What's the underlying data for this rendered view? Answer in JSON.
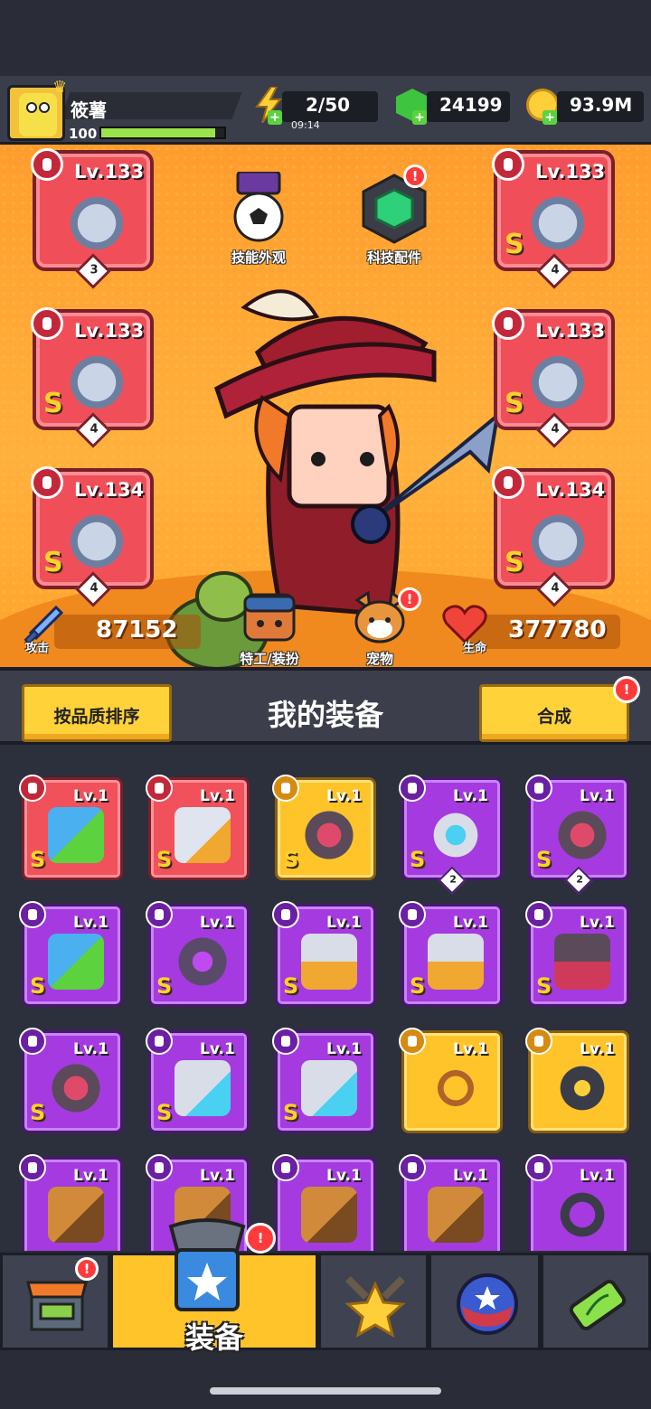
{
  "player": {
    "name": "筱薯",
    "level": "100",
    "xp_fraction": 0.93
  },
  "resources": {
    "energy": "2/50",
    "energy_timer": "09:14",
    "gems": "24199",
    "coins": "93.9M"
  },
  "equipped_slots": [
    {
      "lv": "Lv.133",
      "count": "3",
      "rarity": "",
      "icon": "dagger-icon"
    },
    {
      "lv": "Lv.133",
      "count": "4",
      "rarity": "S",
      "icon": "armor-icon"
    },
    {
      "lv": "Lv.133",
      "count": "4",
      "rarity": "S",
      "icon": "star-ring-icon"
    },
    {
      "lv": "Lv.133",
      "count": "4",
      "rarity": "S",
      "icon": "belt-icon"
    },
    {
      "lv": "Lv.134",
      "count": "4",
      "rarity": "S",
      "icon": "gauntlet-icon"
    },
    {
      "lv": "Lv.134",
      "count": "4",
      "rarity": "S",
      "icon": "boot-icon"
    }
  ],
  "center_buttons": {
    "skill_appearance": "技能外观",
    "tech_parts": "科技配件",
    "agent_outfit": "特工/装扮",
    "pet": "宠物",
    "badge": "!"
  },
  "stats": {
    "attack_label": "攻击",
    "attack_value": "87152",
    "hp_label": "生命",
    "hp_value": "377780"
  },
  "inventory_header": {
    "sort_button": "按品质排序",
    "title": "我的装备",
    "merge_button": "合成",
    "badge": "!"
  },
  "inventory": [
    {
      "color": "red",
      "lv": "Lv.1",
      "rarity": "S",
      "count": "",
      "icon": "water-gun-icon"
    },
    {
      "color": "red",
      "lv": "Lv.1",
      "rarity": "S",
      "count": "",
      "icon": "boot-icon"
    },
    {
      "color": "yellow",
      "lv": "Lv.1",
      "rarity": "S",
      "count": "",
      "icon": "belt-icon"
    },
    {
      "color": "purple",
      "lv": "Lv.1",
      "rarity": "S",
      "count": "2",
      "icon": "star-ring-icon"
    },
    {
      "color": "purple",
      "lv": "Lv.1",
      "rarity": "S",
      "count": "2",
      "icon": "belt-icon"
    },
    {
      "color": "purple",
      "lv": "Lv.1",
      "rarity": "S",
      "count": "",
      "icon": "water-gun-icon"
    },
    {
      "color": "purple",
      "lv": "Lv.1",
      "rarity": "S",
      "count": "",
      "icon": "shuriken-blade-icon"
    },
    {
      "color": "purple",
      "lv": "Lv.1",
      "rarity": "S",
      "count": "",
      "icon": "armor-icon"
    },
    {
      "color": "purple",
      "lv": "Lv.1",
      "rarity": "S",
      "count": "",
      "icon": "armor-icon"
    },
    {
      "color": "purple",
      "lv": "Lv.1",
      "rarity": "S",
      "count": "",
      "icon": "dark-armor-icon"
    },
    {
      "color": "purple",
      "lv": "Lv.1",
      "rarity": "S",
      "count": "",
      "icon": "belt-icon"
    },
    {
      "color": "purple",
      "lv": "Lv.1",
      "rarity": "S",
      "count": "",
      "icon": "gauntlet-icon"
    },
    {
      "color": "purple",
      "lv": "Lv.1",
      "rarity": "S",
      "count": "",
      "icon": "gauntlet-icon"
    },
    {
      "color": "yellow",
      "lv": "Lv.1",
      "rarity": "",
      "count": "",
      "icon": "fang-necklace-icon"
    },
    {
      "color": "yellow",
      "lv": "Lv.1",
      "rarity": "",
      "count": "",
      "icon": "star-collar-icon"
    },
    {
      "color": "purple",
      "lv": "Lv.1",
      "rarity": "",
      "count": "",
      "icon": "bat-icon"
    },
    {
      "color": "purple",
      "lv": "Lv.1",
      "rarity": "",
      "count": "",
      "icon": "bat-icon"
    },
    {
      "color": "purple",
      "lv": "Lv.1",
      "rarity": "",
      "count": "",
      "icon": "bat-icon"
    },
    {
      "color": "purple",
      "lv": "Lv.1",
      "rarity": "",
      "count": "",
      "icon": "bat-icon"
    },
    {
      "color": "purple",
      "lv": "Lv.1",
      "rarity": "",
      "count": "",
      "icon": "spiked-collar-icon"
    }
  ],
  "bottom_nav": {
    "tabs": [
      {
        "icon": "shop-icon",
        "label": "",
        "badge": "!"
      },
      {
        "icon": "equipment-icon",
        "label": "装备",
        "badge": "!"
      },
      {
        "icon": "battle-star-icon",
        "label": "",
        "badge": ""
      },
      {
        "icon": "star-ball-icon",
        "label": "",
        "badge": ""
      },
      {
        "icon": "dna-battery-icon",
        "label": "",
        "badge": ""
      }
    ]
  },
  "colors": {
    "stage_orange": "#ff9d2e",
    "slot_red": "#f04f5a",
    "item_purple": "#a53ae0",
    "item_yellow": "#ffc42a",
    "button_yellow": "#ffd23a"
  }
}
